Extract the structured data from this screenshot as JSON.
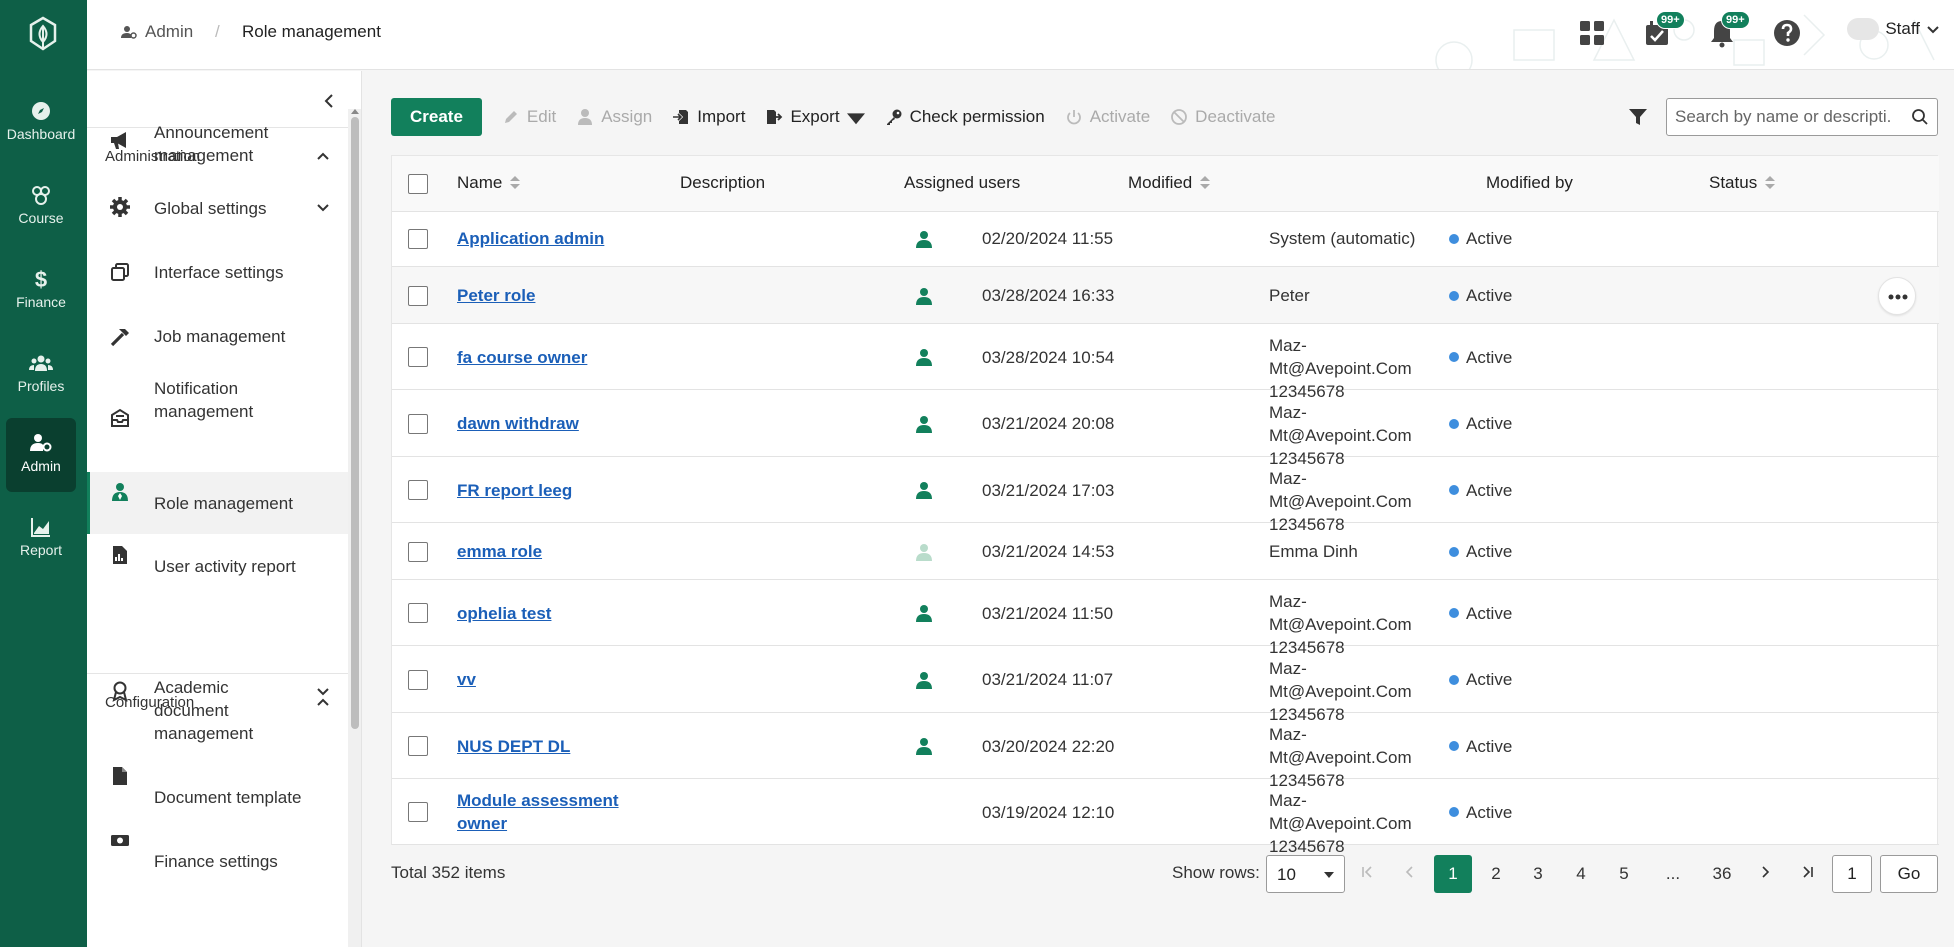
{
  "colors": {
    "brand": "#0e5f47",
    "accent": "#12805c",
    "link": "#1b5fb8",
    "status_active": "#3e8ede"
  },
  "rail": [
    {
      "label": "Dashboard",
      "icon": "compass-icon"
    },
    {
      "label": "Course",
      "icon": "course-icon"
    },
    {
      "label": "Finance",
      "icon": "dollar-icon"
    },
    {
      "label": "Profiles",
      "icon": "people-icon"
    },
    {
      "label": "Admin",
      "icon": "admin-icon",
      "active": true
    },
    {
      "label": "Report",
      "icon": "chart-icon"
    }
  ],
  "breadcrumb": {
    "parent": "Admin",
    "separator": "/",
    "current": "Role management"
  },
  "topbar": {
    "tasks_badge": "99+",
    "notifications_badge": "99+",
    "user": "Staff"
  },
  "sidenav": {
    "sections": [
      {
        "title": "Administration",
        "items": [
          {
            "label": "Announcement management",
            "icon": "megaphone-icon"
          },
          {
            "label": "Global settings",
            "icon": "gear-icon",
            "expandable": true
          },
          {
            "label": "Interface settings",
            "icon": "windows-icon"
          },
          {
            "label": "Job management",
            "icon": "hammer-icon"
          },
          {
            "label": "Notification management",
            "icon": "inbox-icon"
          },
          {
            "label": "Role management",
            "icon": "user-role-icon",
            "active": true
          },
          {
            "label": "User activity report",
            "icon": "report-file-icon"
          }
        ]
      },
      {
        "title": "Configuration",
        "items": [
          {
            "label": "Academic document management",
            "icon": "certificate-icon",
            "expandable": true
          },
          {
            "label": "Document template",
            "icon": "document-icon"
          },
          {
            "label": "Finance settings",
            "icon": "money-icon"
          }
        ]
      }
    ]
  },
  "toolbar": {
    "create": "Create",
    "edit": "Edit",
    "assign": "Assign",
    "import": "Import",
    "export": "Export",
    "check_permission": "Check permission",
    "activate": "Activate",
    "deactivate": "Deactivate",
    "search_placeholder": "Search by name or descripti..."
  },
  "table": {
    "columns": [
      "Name",
      "Description",
      "Assigned users",
      "Modified",
      "Modified by",
      "Status"
    ],
    "rows": [
      {
        "name": "Application admin",
        "description": "",
        "assigned": "filled",
        "modified": "02/20/2024 11:55",
        "modified_by": "System (automatic)",
        "status": "Active"
      },
      {
        "name": "Peter role",
        "description": "",
        "assigned": "filled",
        "modified": "03/28/2024 16:33",
        "modified_by": "Peter",
        "status": "Active"
      },
      {
        "name": "fa course owner",
        "description": "",
        "assigned": "filled",
        "modified": "03/28/2024 10:54",
        "modified_by": "Maz-Mt@Avepoint.Com 12345678",
        "status": "Active"
      },
      {
        "name": "dawn withdraw",
        "description": "",
        "assigned": "filled",
        "modified": "03/21/2024 20:08",
        "modified_by": "Maz-Mt@Avepoint.Com 12345678",
        "status": "Active"
      },
      {
        "name": "FR report leeg",
        "description": "",
        "assigned": "filled",
        "modified": "03/21/2024 17:03",
        "modified_by": "Maz-Mt@Avepoint.Com 12345678",
        "status": "Active"
      },
      {
        "name": "emma role",
        "description": "",
        "assigned": "faded",
        "modified": "03/21/2024 14:53",
        "modified_by": "Emma Dinh",
        "status": "Active"
      },
      {
        "name": "ophelia test",
        "description": "",
        "assigned": "filled",
        "modified": "03/21/2024 11:50",
        "modified_by": "Maz-Mt@Avepoint.Com 12345678",
        "status": "Active"
      },
      {
        "name": "vv",
        "description": "",
        "assigned": "filled",
        "modified": "03/21/2024 11:07",
        "modified_by": "Maz-Mt@Avepoint.Com 12345678",
        "status": "Active"
      },
      {
        "name": "NUS DEPT DL",
        "description": "",
        "assigned": "filled",
        "modified": "03/20/2024 22:20",
        "modified_by": "Maz-Mt@Avepoint.Com 12345678",
        "status": "Active"
      },
      {
        "name": "Module assessment owner",
        "description": "",
        "assigned": "none",
        "modified": "03/19/2024 12:10",
        "modified_by": "Maz-Mt@Avepoint.Com 12345678",
        "status": "Active"
      }
    ]
  },
  "footer": {
    "total": "Total 352 items",
    "show_rows_label": "Show rows:",
    "rows_value": "10",
    "pages": [
      "1",
      "2",
      "3",
      "4",
      "5",
      "...",
      "36"
    ],
    "current_page": "1",
    "page_input": "1",
    "go": "Go"
  }
}
